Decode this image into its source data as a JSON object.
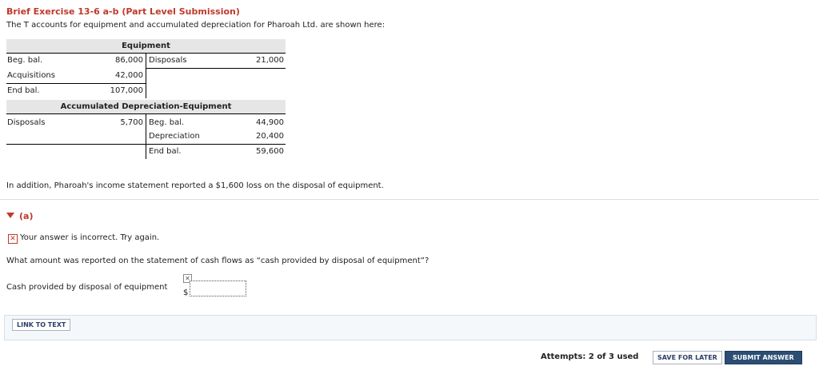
{
  "header": {
    "title": "Brief Exercise 13-6 a-b (Part Level Submission)",
    "intro": "The T accounts for equipment and accumulated depreciation for Pharoah Ltd. are shown here:"
  },
  "equipment": {
    "title": "Equipment",
    "rows": [
      {
        "left_label": "Beg. bal.",
        "left_amount": "86,000",
        "right_label": "Disposals",
        "right_amount": "21,000"
      },
      {
        "left_label": "Acquisitions",
        "left_amount": "42,000",
        "right_label": "",
        "right_amount": ""
      },
      {
        "left_label": "End bal.",
        "left_amount": "107,000",
        "right_label": "",
        "right_amount": ""
      }
    ]
  },
  "accum_dep": {
    "title": "Accumulated Depreciation-Equipment",
    "rows": [
      {
        "left_label": "Disposals",
        "left_amount": "5,700",
        "right_label": "Beg. bal.",
        "right_amount": "44,900"
      },
      {
        "left_label": "",
        "left_amount": "",
        "right_label": "Depreciation",
        "right_amount": "20,400"
      },
      {
        "left_label": "",
        "left_amount": "",
        "right_label": "End bal.",
        "right_amount": "59,600"
      }
    ]
  },
  "note": "In addition, Pharoah's income statement reported a $1,600 loss on the disposal of equipment.",
  "part_a": {
    "label": "(a)",
    "status_icon": "x-icon",
    "status_text": "Your answer is incorrect.  Try again.",
    "question": "What amount was reported on the statement of cash flows as “cash provided by disposal of equipment”?",
    "input_label": "Cash provided by disposal of equipment",
    "currency": "$",
    "input_value": ""
  },
  "footer": {
    "link_label": "LINK TO TEXT",
    "attempts": "Attempts: 2 of 3 used",
    "save_label": "SAVE FOR LATER",
    "submit_label": "SUBMIT ANSWER"
  },
  "colors": {
    "accent_red": "#c0392b",
    "button_navy": "#2c4d74"
  }
}
